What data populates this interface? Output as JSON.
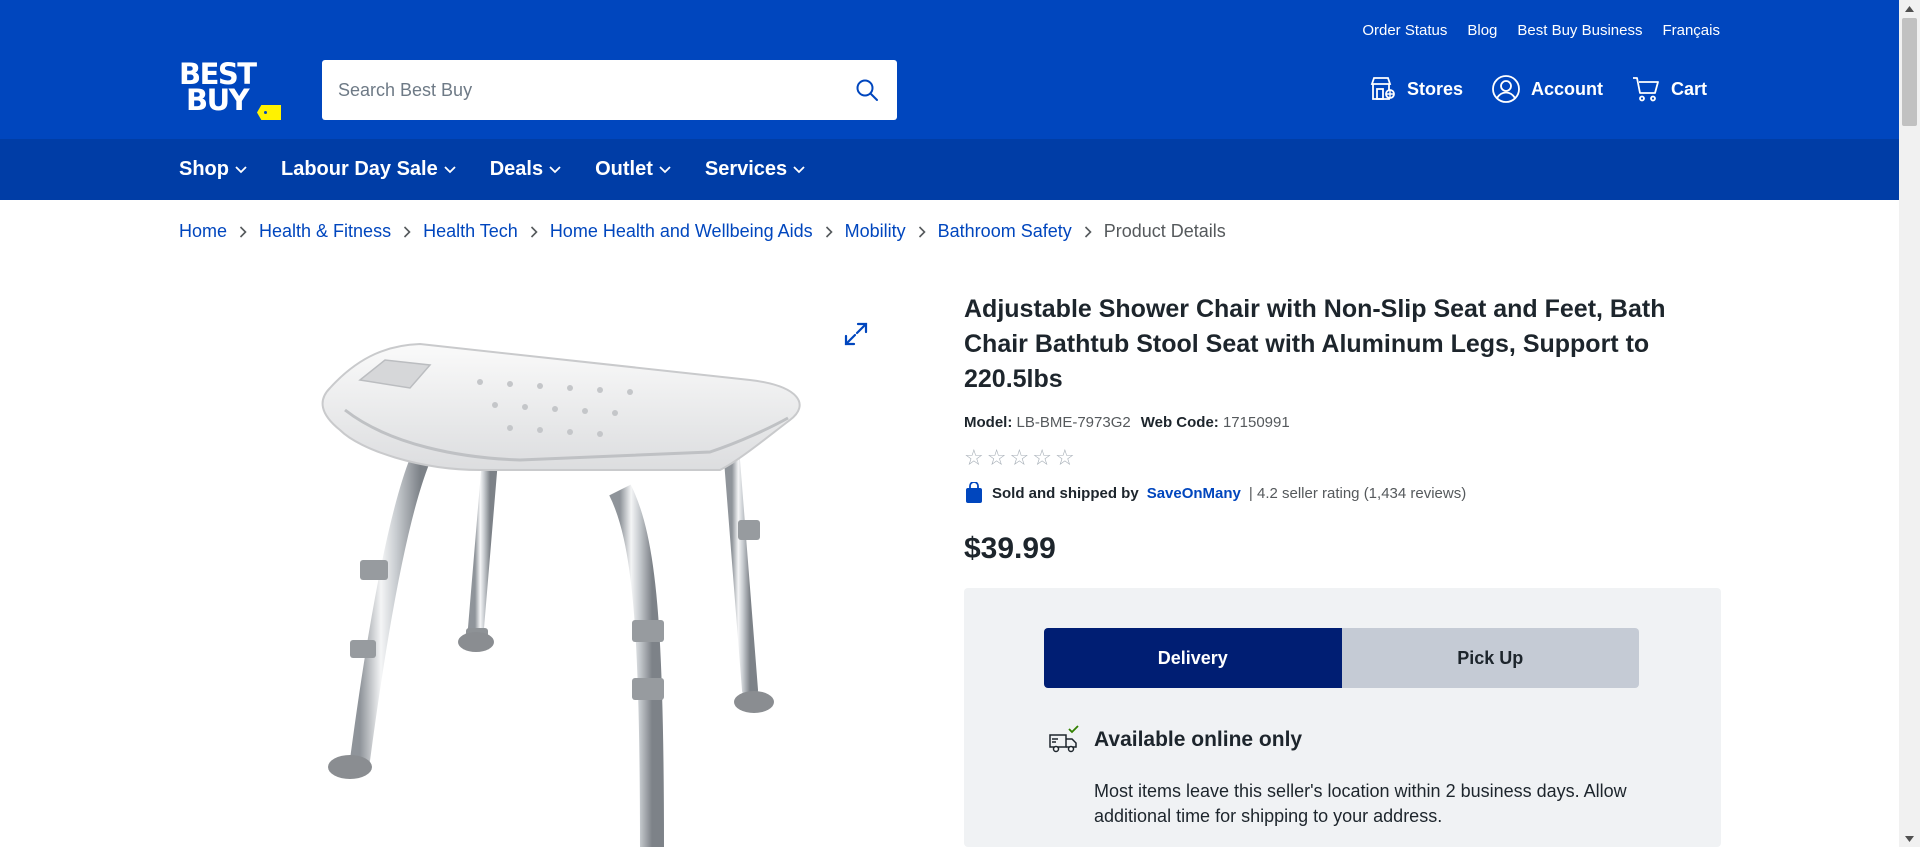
{
  "header": {
    "utility_links": [
      "Order Status",
      "Blog",
      "Best Buy Business",
      "Français"
    ],
    "logo": {
      "line1": "BEST",
      "line2": "BUY",
      "tag_color": "#fff200"
    },
    "search": {
      "placeholder": "Search Best Buy",
      "value": ""
    },
    "actions": {
      "stores": "Stores",
      "account": "Account",
      "cart": "Cart"
    },
    "nav": [
      "Shop",
      "Labour Day Sale",
      "Deals",
      "Outlet",
      "Services"
    ],
    "brand_color": "#0046be",
    "nav_color": "#003da6"
  },
  "breadcrumb": {
    "links": [
      "Home",
      "Health & Fitness",
      "Health Tech",
      "Home Health and Wellbeing Aids",
      "Mobility",
      "Bathroom Safety"
    ],
    "current": "Product Details"
  },
  "product": {
    "title": "Adjustable Shower Chair with Non-Slip Seat and Feet, Bath Chair Bathtub Stool Seat with Aluminum Legs, Support to 220.5lbs",
    "model_label": "Model:",
    "model": "LB-BME-7973G2",
    "webcode_label": "Web Code:",
    "webcode": "17150991",
    "rating_stars_filled": 0,
    "rating_stars_total": 5,
    "sold_by_label": "Sold and shipped by",
    "seller": "SaveOnMany",
    "seller_rating": "| 4.2 seller rating (1,434 reviews)",
    "price": "$39.99",
    "image_icon": "shower-chair-image"
  },
  "fulfillment": {
    "tabs": [
      "Delivery",
      "Pick Up"
    ],
    "selected": "Delivery",
    "availability_title": "Available online only",
    "availability_desc": "Most items leave this seller's location within 2 business days. Allow additional time for shipping to your address.",
    "check_color": "#318000"
  }
}
